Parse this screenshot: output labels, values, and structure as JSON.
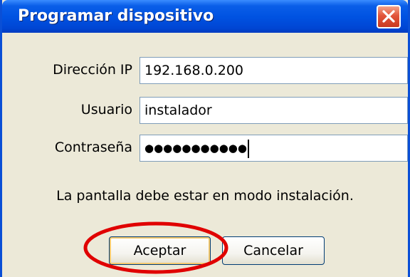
{
  "dialog": {
    "title": "Programar dispositivo"
  },
  "icons": {
    "close": "close-icon",
    "annotation": "red-ellipse-highlight"
  },
  "colors": {
    "titlebar": "#0053e2",
    "window_border": "#0a4fd6",
    "dialog_bg": "#ece9d8",
    "close_button": "#e2543a",
    "annotation": "#e00000"
  },
  "form": {
    "ip_label": "Dirección IP",
    "ip_value": "192.168.0.200",
    "user_label": "Usuario",
    "user_value": "instalador",
    "password_label": "Contraseña",
    "password_value": "●●●●●●●●●●●"
  },
  "message": "La pantalla debe estar en modo instalación.",
  "buttons": {
    "accept": "Aceptar",
    "cancel": "Cancelar"
  }
}
